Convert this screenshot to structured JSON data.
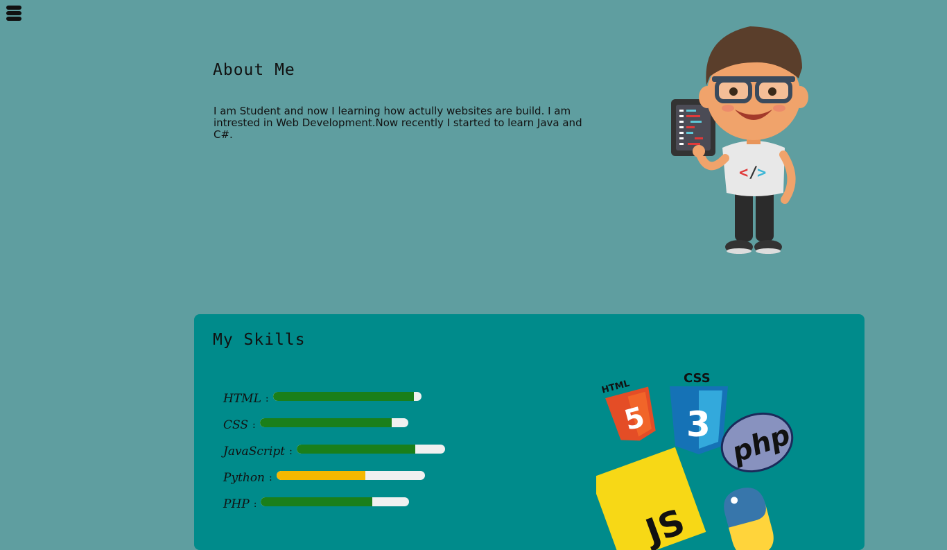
{
  "about": {
    "title": "About Me",
    "text": "I am Student and now I learning how actully websites are build. I am intrested in Web Development.Now recently I started to learn Java and C#."
  },
  "skills": {
    "title": "My Skills",
    "items": [
      {
        "label": "HTML",
        "colon": ":",
        "level": 0.95,
        "color": "#1a7f1a"
      },
      {
        "label": "CSS",
        "colon": ":",
        "level": 0.89,
        "color": "#1a7f1a"
      },
      {
        "label": "JavaScript",
        "colon": ":",
        "level": 0.8,
        "color": "#1a7f1a"
      },
      {
        "label": "Python",
        "colon": ":",
        "level": 0.6,
        "color": "#f5b800"
      },
      {
        "label": "PHP",
        "colon": ":",
        "level": 0.75,
        "color": "#1a7f1a"
      }
    ],
    "logos": {
      "html": "HTML",
      "html_glyph": "5",
      "css": "CSS",
      "css_glyph": "3",
      "php": "php",
      "js": "JS"
    }
  },
  "icons": {
    "menu": "hamburger-menu-icon",
    "avatar": "developer-avatar-illustration"
  }
}
